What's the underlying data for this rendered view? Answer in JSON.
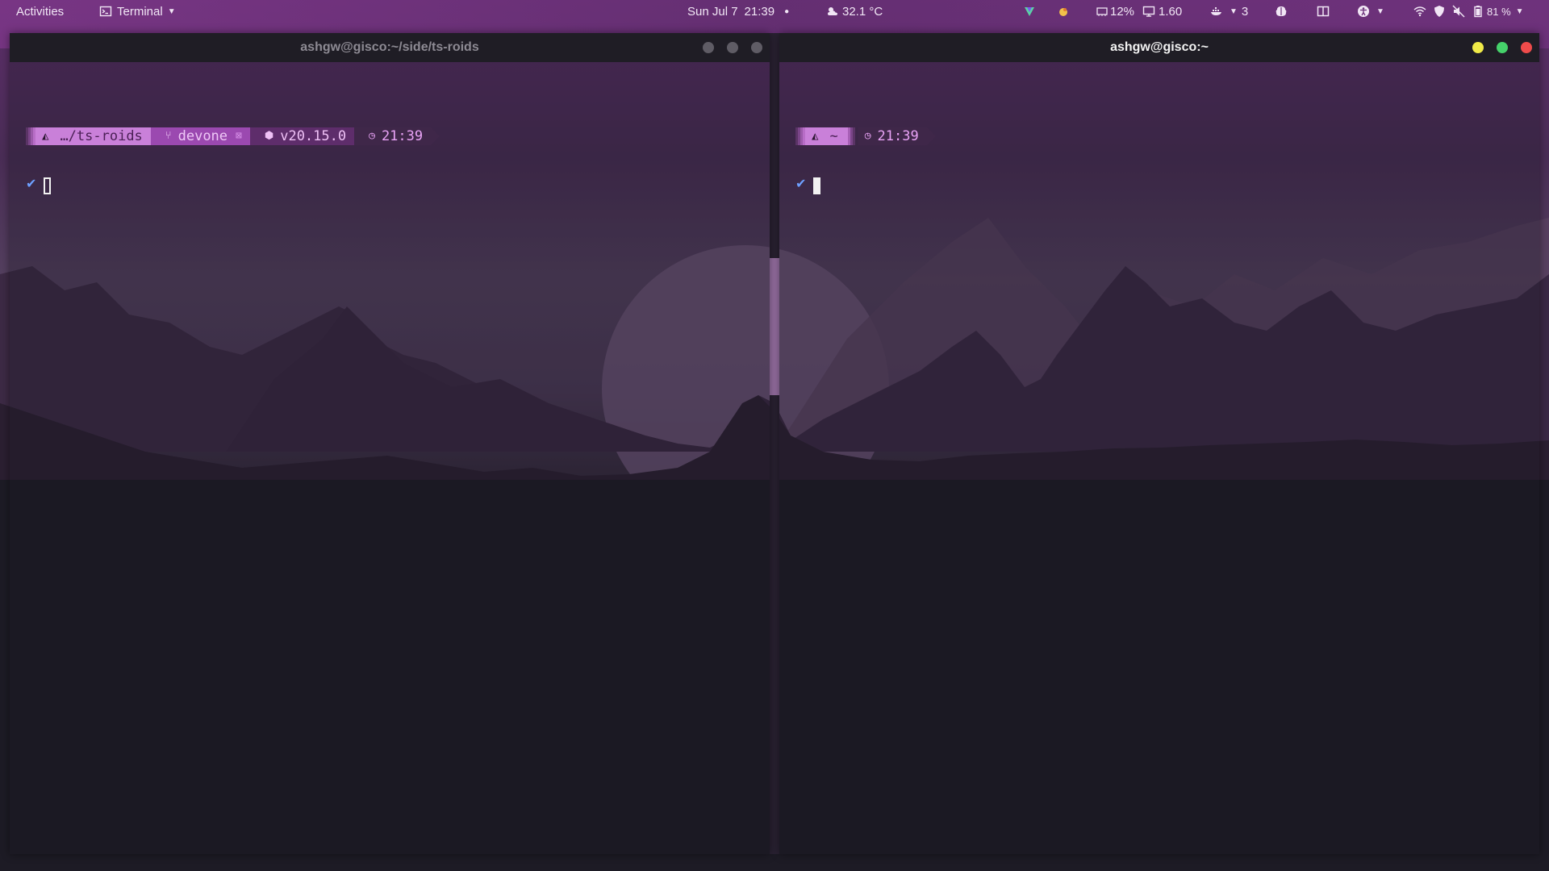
{
  "topbar": {
    "activities": "Activities",
    "app_menu": {
      "icon": "terminal-icon",
      "label": "Terminal"
    },
    "date": "Sun Jul 7",
    "time": "21:39",
    "temperature": "32.1 °C",
    "cpu": "12%",
    "load": "1.60",
    "docker_count": "3",
    "battery": "81 %"
  },
  "windows": [
    {
      "title": "ashgw@gisco:~/side/ts-roids",
      "focused": false,
      "prompt": {
        "os_icon": "linux-icon",
        "dir": "…/ts-roids",
        "git_branch": "devone",
        "node_version": "v20.15.0",
        "time": "21:39"
      },
      "status_mark": "✔"
    },
    {
      "title": "ashgw@gisco:~",
      "focused": true,
      "prompt": {
        "os_icon": "linux-icon",
        "dir": "~",
        "time": "21:39"
      },
      "status_mark": "✔"
    }
  ],
  "colors": {
    "close": "#ef4b4b",
    "maximize": "#45d16a",
    "minimize": "#f0ea48",
    "inactive_button": "#5f5c65",
    "prompt_accent": "#c980d9",
    "check": "#6ea0ff"
  }
}
